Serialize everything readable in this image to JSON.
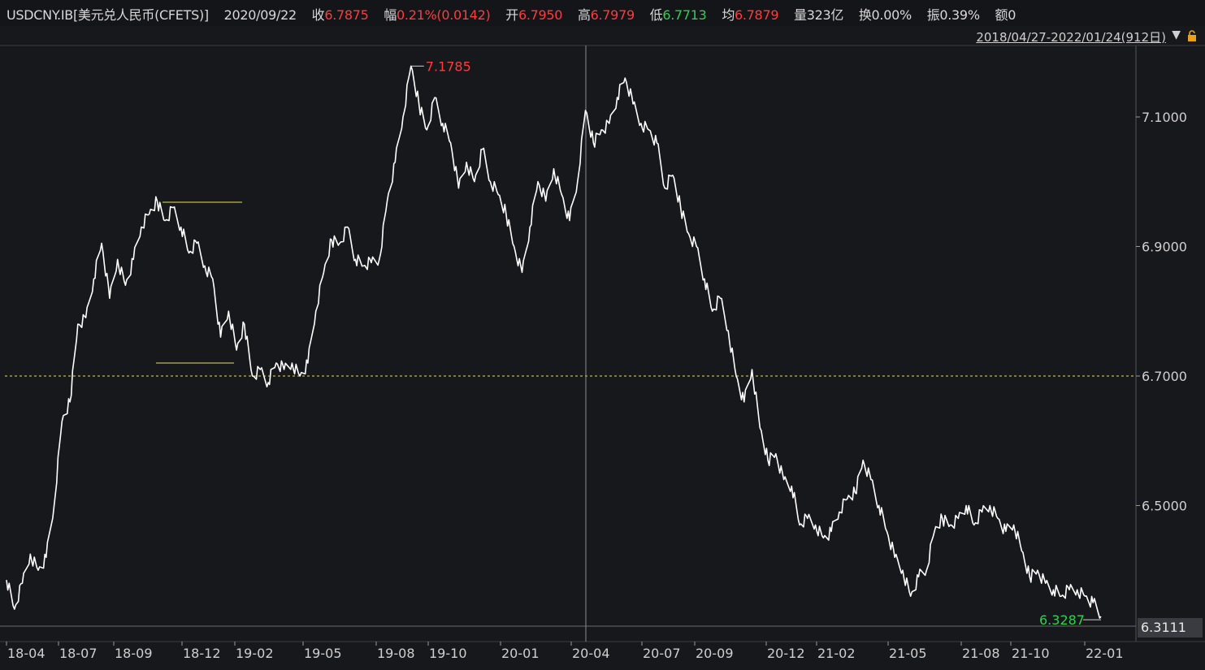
{
  "header": {
    "symbol": "USDCNY.IB[美元兑人民币(CFETS)]",
    "date": "2020/09/22",
    "close_label": "收",
    "close_value": "6.7875",
    "change_label": "幅",
    "change_value": "0.21%(0.0142)",
    "open_label": "开",
    "open_value": "6.7950",
    "high_label": "高",
    "high_value": "6.7979",
    "low_label": "低",
    "low_value": "6.7713",
    "avg_label": "均",
    "avg_value": "6.7879",
    "volume_label": "量",
    "volume_value": "323亿",
    "turnover_label": "换",
    "turnover_value": "0.00%",
    "amplitude_label": "振",
    "amplitude_value": "0.39%",
    "amount_label": "额",
    "amount_value": "0"
  },
  "range": {
    "label": "2018/04/27-2022/01/24(912日)",
    "arrow_icon": "triangle-down-icon",
    "lock_icon": "lock-icon"
  },
  "colors": {
    "background": "#17181c",
    "line": "#ffffff",
    "up": "#ff3b3b",
    "down": "#2bd34a",
    "reference": "#e6e05a",
    "grid": "#3a3b40"
  },
  "chart_data": {
    "type": "line",
    "title": "",
    "y_ticks": [
      "7.1000",
      "6.9000",
      "6.7000",
      "6.5000"
    ],
    "y_tick_values": [
      7.1,
      6.9,
      6.7,
      6.5
    ],
    "x_ticks": [
      "18-04",
      "18-07",
      "18-09",
      "18-12",
      "19-02",
      "19-05",
      "19-08",
      "19-10",
      "20-01",
      "20-04",
      "20-07",
      "20-09",
      "20-12",
      "21-02",
      "21-05",
      "21-08",
      "21-10",
      "22-01"
    ],
    "ylim": [
      6.3111,
      7.2
    ],
    "reference_line": 6.7,
    "max_label": "7.1785",
    "min_label": "6.3287",
    "last_value_label": "6.3111",
    "crosshair_x_label": "20-04",
    "series": [
      {
        "values": [
          {
            "x": "18-04",
            "y": 6.385
          },
          {
            "x": "18-04",
            "y": 6.34
          },
          {
            "x": "18-05",
            "y": 6.38
          },
          {
            "x": "18-05",
            "y": 6.425
          },
          {
            "x": "18-05",
            "y": 6.4
          },
          {
            "x": "18-06",
            "y": 6.42
          },
          {
            "x": "18-06",
            "y": 6.5
          },
          {
            "x": "18-06",
            "y": 6.63
          },
          {
            "x": "18-07",
            "y": 6.66
          },
          {
            "x": "18-07",
            "y": 6.78
          },
          {
            "x": "18-07",
            "y": 6.79
          },
          {
            "x": "18-07",
            "y": 6.85
          },
          {
            "x": "18-08",
            "y": 6.905
          },
          {
            "x": "18-08",
            "y": 6.82
          },
          {
            "x": "18-08",
            "y": 6.88
          },
          {
            "x": "18-08",
            "y": 6.84
          },
          {
            "x": "18-09",
            "y": 6.88
          },
          {
            "x": "18-09",
            "y": 6.93
          },
          {
            "x": "18-09",
            "y": 6.95
          },
          {
            "x": "18-10",
            "y": 6.97
          },
          {
            "x": "18-10",
            "y": 6.94
          },
          {
            "x": "18-10",
            "y": 6.96
          },
          {
            "x": "18-11",
            "y": 6.93
          },
          {
            "x": "18-11",
            "y": 6.89
          },
          {
            "x": "18-11",
            "y": 6.905
          },
          {
            "x": "18-11",
            "y": 6.87
          },
          {
            "x": "18-12",
            "y": 6.85
          },
          {
            "x": "18-12",
            "y": 6.76
          },
          {
            "x": "18-12",
            "y": 6.8
          },
          {
            "x": "19-01",
            "y": 6.74
          },
          {
            "x": "19-01",
            "y": 6.78
          },
          {
            "x": "19-01",
            "y": 6.7
          },
          {
            "x": "19-02",
            "y": 6.71
          },
          {
            "x": "19-02",
            "y": 6.69
          },
          {
            "x": "19-02",
            "y": 6.72
          },
          {
            "x": "19-03",
            "y": 6.71
          },
          {
            "x": "19-03",
            "y": 6.72
          },
          {
            "x": "19-03",
            "y": 6.7
          },
          {
            "x": "19-04",
            "y": 6.72
          },
          {
            "x": "19-04",
            "y": 6.8
          },
          {
            "x": "19-04",
            "y": 6.86
          },
          {
            "x": "19-05",
            "y": 6.91
          },
          {
            "x": "19-05",
            "y": 6.905
          },
          {
            "x": "19-05",
            "y": 6.93
          },
          {
            "x": "19-06",
            "y": 6.88
          },
          {
            "x": "19-06",
            "y": 6.87
          },
          {
            "x": "19-06",
            "y": 6.875
          },
          {
            "x": "19-07",
            "y": 6.88
          },
          {
            "x": "19-07",
            "y": 6.97
          },
          {
            "x": "19-08",
            "y": 7.03
          },
          {
            "x": "19-08",
            "y": 7.1
          },
          {
            "x": "19-08",
            "y": 7.1785
          },
          {
            "x": "19-08",
            "y": 7.12
          },
          {
            "x": "19-09",
            "y": 7.08
          },
          {
            "x": "19-09",
            "y": 7.13
          },
          {
            "x": "19-09",
            "y": 7.09
          },
          {
            "x": "19-10",
            "y": 7.06
          },
          {
            "x": "19-10",
            "y": 6.99
          },
          {
            "x": "19-10",
            "y": 7.03
          },
          {
            "x": "19-11",
            "y": 7.0
          },
          {
            "x": "19-11",
            "y": 7.05
          },
          {
            "x": "19-11",
            "y": 7.0
          },
          {
            "x": "19-12",
            "y": 6.98
          },
          {
            "x": "19-12",
            "y": 6.95
          },
          {
            "x": "20-01",
            "y": 6.9
          },
          {
            "x": "20-01",
            "y": 6.86
          },
          {
            "x": "20-01",
            "y": 6.93
          },
          {
            "x": "20-01",
            "y": 7.0
          },
          {
            "x": "20-02",
            "y": 6.97
          },
          {
            "x": "20-02",
            "y": 7.02
          },
          {
            "x": "20-02",
            "y": 6.98
          },
          {
            "x": "20-03",
            "y": 6.94
          },
          {
            "x": "20-03",
            "y": 7.0
          },
          {
            "x": "20-03",
            "y": 7.11
          },
          {
            "x": "20-04",
            "y": 7.06
          },
          {
            "x": "20-04",
            "y": 7.08
          },
          {
            "x": "20-04",
            "y": 7.09
          },
          {
            "x": "20-05",
            "y": 7.13
          },
          {
            "x": "20-05",
            "y": 7.16
          },
          {
            "x": "20-05",
            "y": 7.12
          },
          {
            "x": "20-06",
            "y": 7.09
          },
          {
            "x": "20-06",
            "y": 7.08
          },
          {
            "x": "20-06",
            "y": 7.06
          },
          {
            "x": "20-07",
            "y": 6.99
          },
          {
            "x": "20-07",
            "y": 7.01
          },
          {
            "x": "20-07",
            "y": 6.96
          },
          {
            "x": "20-08",
            "y": 6.92
          },
          {
            "x": "20-08",
            "y": 6.9
          },
          {
            "x": "20-08",
            "y": 6.85
          },
          {
            "x": "20-09",
            "y": 6.8
          },
          {
            "x": "20-09",
            "y": 6.82
          },
          {
            "x": "20-09",
            "y": 6.77
          },
          {
            "x": "20-10",
            "y": 6.7
          },
          {
            "x": "20-10",
            "y": 6.66
          },
          {
            "x": "20-10",
            "y": 6.71
          },
          {
            "x": "20-11",
            "y": 6.62
          },
          {
            "x": "20-11",
            "y": 6.57
          },
          {
            "x": "20-11",
            "y": 6.58
          },
          {
            "x": "20-12",
            "y": 6.54
          },
          {
            "x": "20-12",
            "y": 6.53
          },
          {
            "x": "20-12",
            "y": 6.47
          },
          {
            "x": "21-01",
            "y": 6.48
          },
          {
            "x": "21-01",
            "y": 6.47
          },
          {
            "x": "21-01",
            "y": 6.45
          },
          {
            "x": "21-02",
            "y": 6.46
          },
          {
            "x": "21-02",
            "y": 6.49
          },
          {
            "x": "21-02",
            "y": 6.51
          },
          {
            "x": "21-03",
            "y": 6.52
          },
          {
            "x": "21-03",
            "y": 6.57
          },
          {
            "x": "21-03",
            "y": 6.54
          },
          {
            "x": "21-04",
            "y": 6.5
          },
          {
            "x": "21-04",
            "y": 6.46
          },
          {
            "x": "21-04",
            "y": 6.42
          },
          {
            "x": "21-05",
            "y": 6.4
          },
          {
            "x": "21-05",
            "y": 6.36
          },
          {
            "x": "21-05",
            "y": 6.39
          },
          {
            "x": "21-06",
            "y": 6.4
          },
          {
            "x": "21-06",
            "y": 6.46
          },
          {
            "x": "21-06",
            "y": 6.48
          },
          {
            "x": "21-07",
            "y": 6.47
          },
          {
            "x": "21-07",
            "y": 6.48
          },
          {
            "x": "21-07",
            "y": 6.5
          },
          {
            "x": "21-08",
            "y": 6.47
          },
          {
            "x": "21-08",
            "y": 6.49
          },
          {
            "x": "21-08",
            "y": 6.5
          },
          {
            "x": "21-09",
            "y": 6.48
          },
          {
            "x": "21-09",
            "y": 6.46
          },
          {
            "x": "21-09",
            "y": 6.47
          },
          {
            "x": "21-10",
            "y": 6.43
          },
          {
            "x": "21-10",
            "y": 6.39
          },
          {
            "x": "21-10",
            "y": 6.4
          },
          {
            "x": "21-11",
            "y": 6.38
          },
          {
            "x": "21-11",
            "y": 6.37
          },
          {
            "x": "21-11",
            "y": 6.36
          },
          {
            "x": "21-12",
            "y": 6.37
          },
          {
            "x": "21-12",
            "y": 6.37
          },
          {
            "x": "22-01",
            "y": 6.36
          },
          {
            "x": "22-01",
            "y": 6.35
          },
          {
            "x": "22-01",
            "y": 6.3287
          }
        ]
      }
    ]
  }
}
